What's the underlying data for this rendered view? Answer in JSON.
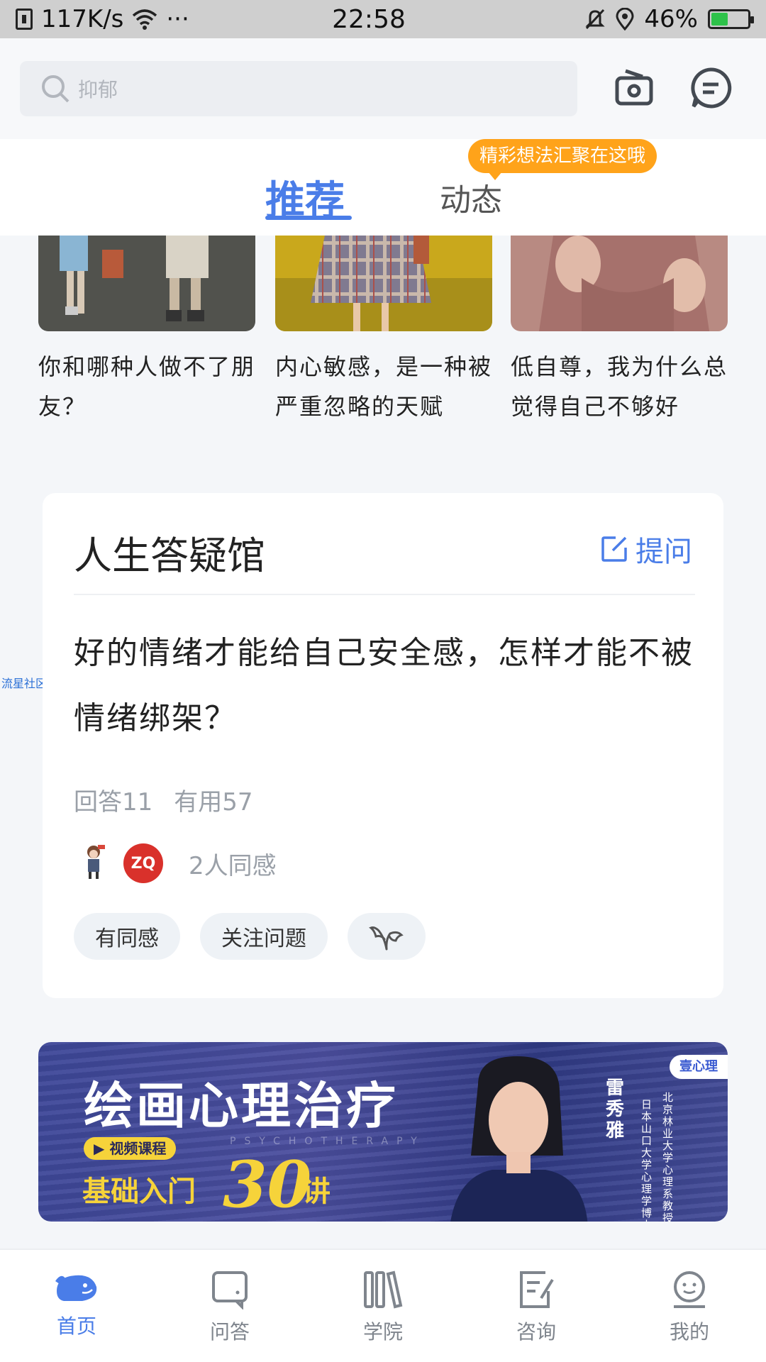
{
  "status_bar": {
    "speed": "117K/s",
    "more": "···",
    "time": "22:58",
    "battery": "46%",
    "battery_level": 0.46
  },
  "search": {
    "placeholder": "抑郁"
  },
  "tabs": {
    "active": "推荐",
    "second": "动态",
    "bubble": "精彩想法汇聚在这哦"
  },
  "articles": [
    {
      "title": "你和哪种人做不了朋友？"
    },
    {
      "title": "内心敏感，是一种被严重忽略的天赋"
    },
    {
      "title": "低自尊，我为什么总觉得自己不够好"
    }
  ],
  "side_label": "流星社区",
  "qa": {
    "title": "人生答疑馆",
    "ask_label": "提问",
    "question": "好的情绪才能给自己安全感，怎样才能不被情绪绑架？",
    "answers": "回答11",
    "useful": "有用57",
    "avatar_zq": "ZQ",
    "empathy_count": "2人同感",
    "btn_empathy": "有同感",
    "btn_follow": "关注问题"
  },
  "banner": {
    "title": "绘画心理治疗",
    "tag": "视频课程",
    "english": "PSYCHOTHERAPY",
    "subtitle": "基础入门",
    "number": "30",
    "unit": "讲",
    "logo": "壹心理",
    "name": "雷秀雅",
    "desc_1": "北京林业大学心理系教授",
    "desc_2": "日本山口大学心理学博士"
  },
  "nav": [
    {
      "label": "首页",
      "icon": "whale-icon"
    },
    {
      "label": "问答",
      "icon": "qa-icon"
    },
    {
      "label": "学院",
      "icon": "books-icon"
    },
    {
      "label": "咨询",
      "icon": "consult-icon"
    },
    {
      "label": "我的",
      "icon": "profile-icon"
    }
  ],
  "colors": {
    "accent": "#4a7de8",
    "bubble": "#ffa31a",
    "tag": "#f6d33a"
  }
}
